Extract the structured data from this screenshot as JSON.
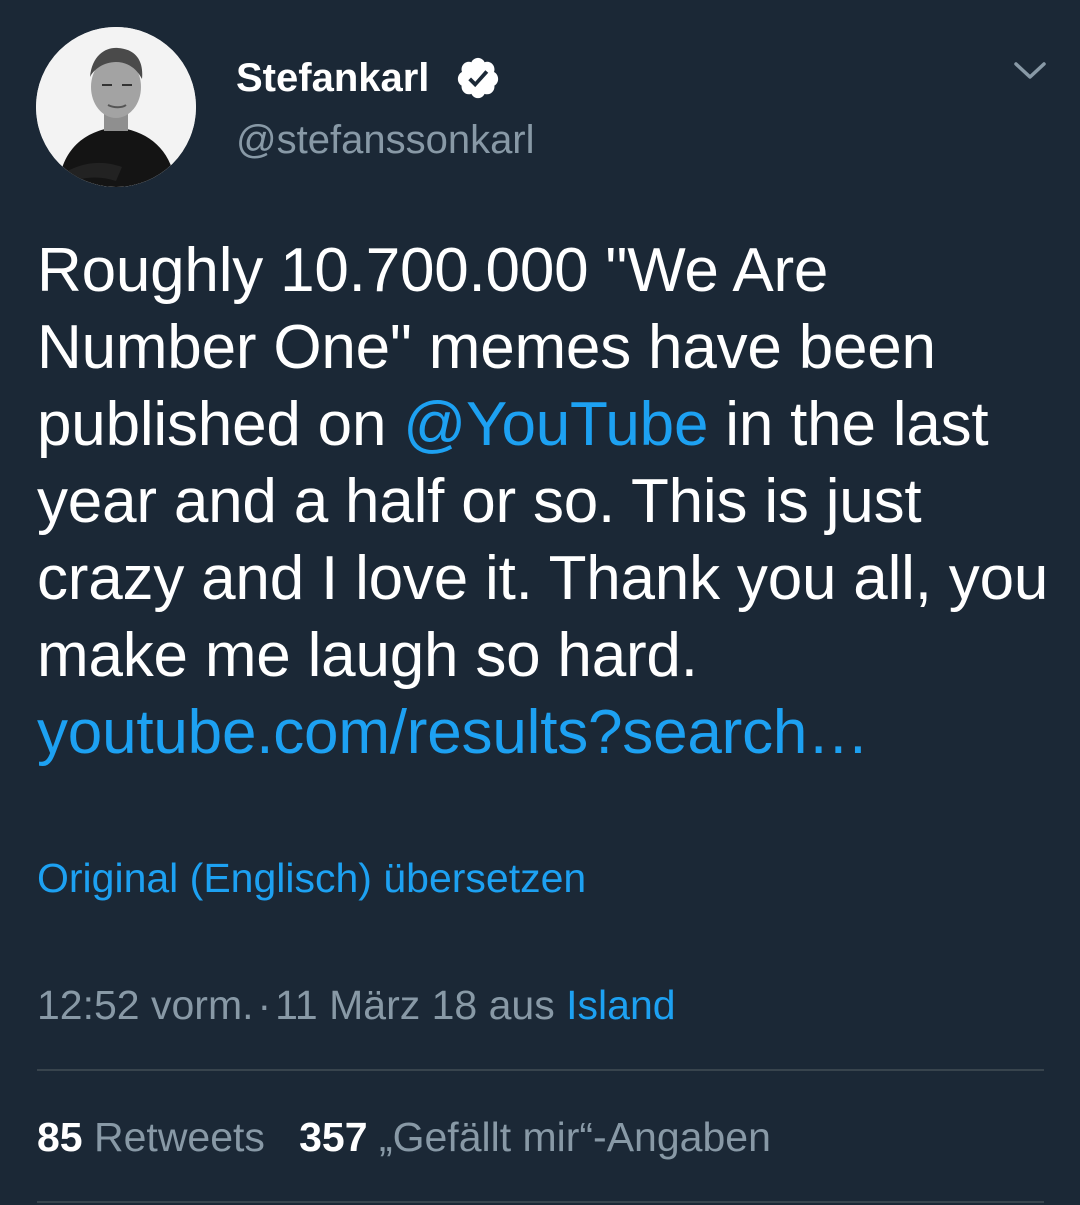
{
  "user": {
    "display_name": "Stefankarl",
    "handle": "@stefanssonkarl",
    "verified": true,
    "avatar_icon": "profile-photo"
  },
  "tweet": {
    "text_part1": "Roughly 10.700.000 \"We Are Number One\" memes have been published on ",
    "mention": "@YouTube",
    "text_part2": " in the last year and a half or so. This is just crazy and I love it. Thank you all, you make me laugh so hard. ",
    "link": "youtube.com/results?search…"
  },
  "translate_label": "Original (Englisch) übersetzen",
  "meta": {
    "time": "12:52 vorm.",
    "separator": "·",
    "date": "11 März 18",
    "from_label": "aus",
    "location": "Island"
  },
  "stats": {
    "retweets_count": "85",
    "retweets_label": "Retweets",
    "likes_count": "357",
    "likes_label": "„Gefällt mir“-Angaben"
  },
  "colors": {
    "background": "#1b2836",
    "link": "#1da1f2",
    "secondary_text": "#8899a6",
    "divider": "#38444d"
  }
}
